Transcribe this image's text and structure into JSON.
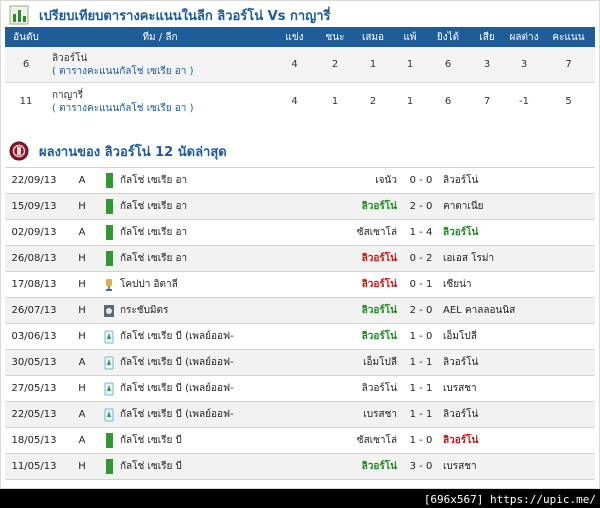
{
  "comparison": {
    "title": "เปรียบเทียบตารางคะแนนในลีก ลิวอร์โน่ Vs กาญารี่",
    "headers": [
      "อันดับ",
      "ทีม / ลีก",
      "แข่ง",
      "ชนะ",
      "เสมอ",
      "แพ้",
      "ยิงได้",
      "เสีย",
      "ผลต่าง",
      "คะแนน"
    ],
    "rows": [
      {
        "rank": "6",
        "team": "ลิวอร์โน่",
        "league": "( ตารางคะแนนกัลโช่ เซเรีย อา )",
        "played": "4",
        "won": "2",
        "drawn": "1",
        "lost": "1",
        "gf": "6",
        "ga": "3",
        "gd": "3",
        "pts": "7"
      },
      {
        "rank": "11",
        "team": "กาญารี่",
        "league": "( ตารางคะแนนกัลโช่ เซเรีย อา )",
        "played": "4",
        "won": "1",
        "drawn": "2",
        "lost": "1",
        "gf": "6",
        "ga": "7",
        "gd": "-1",
        "pts": "5"
      }
    ]
  },
  "recent": {
    "title": "ผลงานของ ลิวอร์โน่ 12 นัดล่าสุด",
    "matches": [
      {
        "date": "22/09/13",
        "venue": "A",
        "icon": "green-bar-icon",
        "league": "กัลโช่ เซเรีย อา",
        "home": "เจนัว",
        "score": "0 - 0",
        "away": "ลิวอร์โน่",
        "home_class": "",
        "away_class": ""
      },
      {
        "date": "15/09/13",
        "venue": "H",
        "icon": "green-bar-icon",
        "league": "กัลโช่ เซเรีย อา",
        "home": "ลิวอร์โน่",
        "score": "2 - 0",
        "away": "คาตาเนีย",
        "home_class": "win",
        "away_class": ""
      },
      {
        "date": "02/09/13",
        "venue": "A",
        "icon": "green-bar-icon",
        "league": "กัลโช่ เซเรีย อา",
        "home": "ซัสเซาโล่",
        "score": "1 - 4",
        "away": "ลิวอร์โน่",
        "home_class": "",
        "away_class": "win"
      },
      {
        "date": "26/08/13",
        "venue": "H",
        "icon": "green-bar-icon",
        "league": "กัลโช่ เซเรีย อา",
        "home": "ลิวอร์โน่",
        "score": "0 - 2",
        "away": "เอเอส โรม่า",
        "home_class": "lose",
        "away_class": ""
      },
      {
        "date": "17/08/13",
        "venue": "H",
        "icon": "coppa-italia-icon",
        "league": "โคปปา อิตาลี",
        "home": "ลิวอร์โน่",
        "score": "0 - 1",
        "away": "เซียน่า",
        "home_class": "lose",
        "away_class": ""
      },
      {
        "date": "26/07/13",
        "venue": "H",
        "icon": "friendly-icon",
        "league": "กระชับมิตร",
        "home": "ลิวอร์โน่",
        "score": "2 - 0",
        "away": "AEL คาลลอนนิส",
        "home_class": "win",
        "away_class": ""
      },
      {
        "date": "03/06/13",
        "venue": "H",
        "icon": "serie-b-icon",
        "league": "กัลโช่ เซเรีย บี (เพลย์ออฟ-",
        "home": "ลิวอร์โน่",
        "score": "1 - 0",
        "away": "เอ็มโปลี",
        "home_class": "win",
        "away_class": ""
      },
      {
        "date": "30/05/13",
        "venue": "A",
        "icon": "serie-b-icon",
        "league": "กัลโช่ เซเรีย บี (เพลย์ออฟ-",
        "home": "เอ็มโปลี",
        "score": "1 - 1",
        "away": "ลิวอร์โน่",
        "home_class": "",
        "away_class": ""
      },
      {
        "date": "27/05/13",
        "venue": "H",
        "icon": "serie-b-icon",
        "league": "กัลโช่ เซเรีย บี (เพลย์ออฟ-",
        "home": "ลิวอร์โน่",
        "score": "1 - 1",
        "away": "เบรสชา",
        "home_class": "",
        "away_class": ""
      },
      {
        "date": "22/05/13",
        "venue": "A",
        "icon": "serie-b-icon",
        "league": "กัลโช่ เซเรีย บี (เพลย์ออฟ-",
        "home": "เบรสชา",
        "score": "1 - 1",
        "away": "ลิวอร์โน่",
        "home_class": "",
        "away_class": ""
      },
      {
        "date": "18/05/13",
        "venue": "A",
        "icon": "green-bar-icon",
        "league": "กัลโช่ เซเรีย บี",
        "home": "ซัสเซาโล่",
        "score": "1 - 0",
        "away": "ลิวอร์โน่",
        "home_class": "",
        "away_class": "lose"
      },
      {
        "date": "11/05/13",
        "venue": "H",
        "icon": "green-bar-icon",
        "league": "กัลโช่ เซเรีย บี",
        "home": "ลิวอร์โน่",
        "score": "3 - 0",
        "away": "เบรสชา",
        "home_class": "win",
        "away_class": ""
      }
    ]
  },
  "watermark": "[696x567] https://upic.me/",
  "colors": {
    "header_bg": "#1f5d99",
    "title": "#1a5a9e",
    "win": "#1a8a1a",
    "lose": "#cc1111",
    "form_bar": "#2e9a2e"
  }
}
